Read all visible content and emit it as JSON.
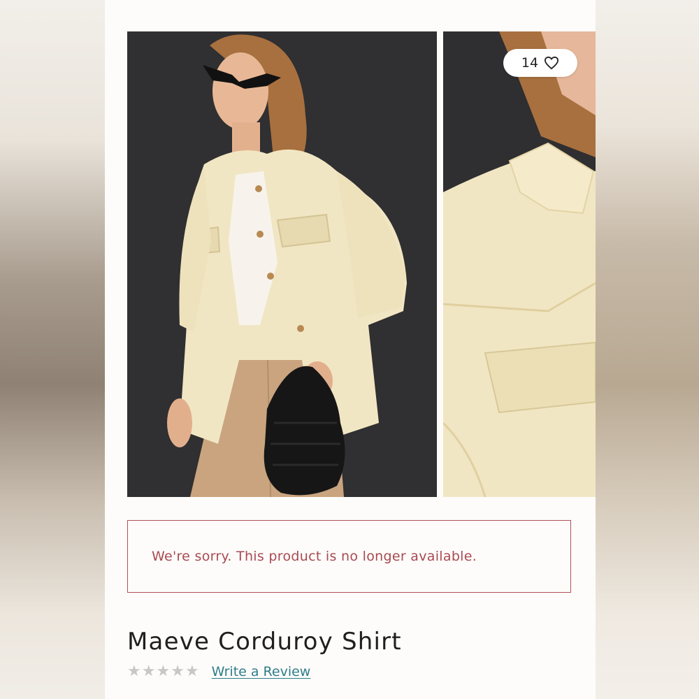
{
  "product": {
    "title": "Maeve Corduroy Shirt",
    "like_count": "14",
    "unavailable_message": "We're sorry. This product is no longer available.",
    "write_review_label": "Write a Review",
    "rating": 0,
    "rating_max": 5,
    "stars": [
      "★",
      "★",
      "★",
      "★",
      "★"
    ]
  },
  "gallery": {
    "dot_count": 5,
    "active_dot_index": 1
  },
  "colors": {
    "notice": "#a84a52",
    "link": "#2f7d8a",
    "star_empty": "#c7c7c7"
  },
  "icons": {
    "like": "heart-outline-icon"
  }
}
